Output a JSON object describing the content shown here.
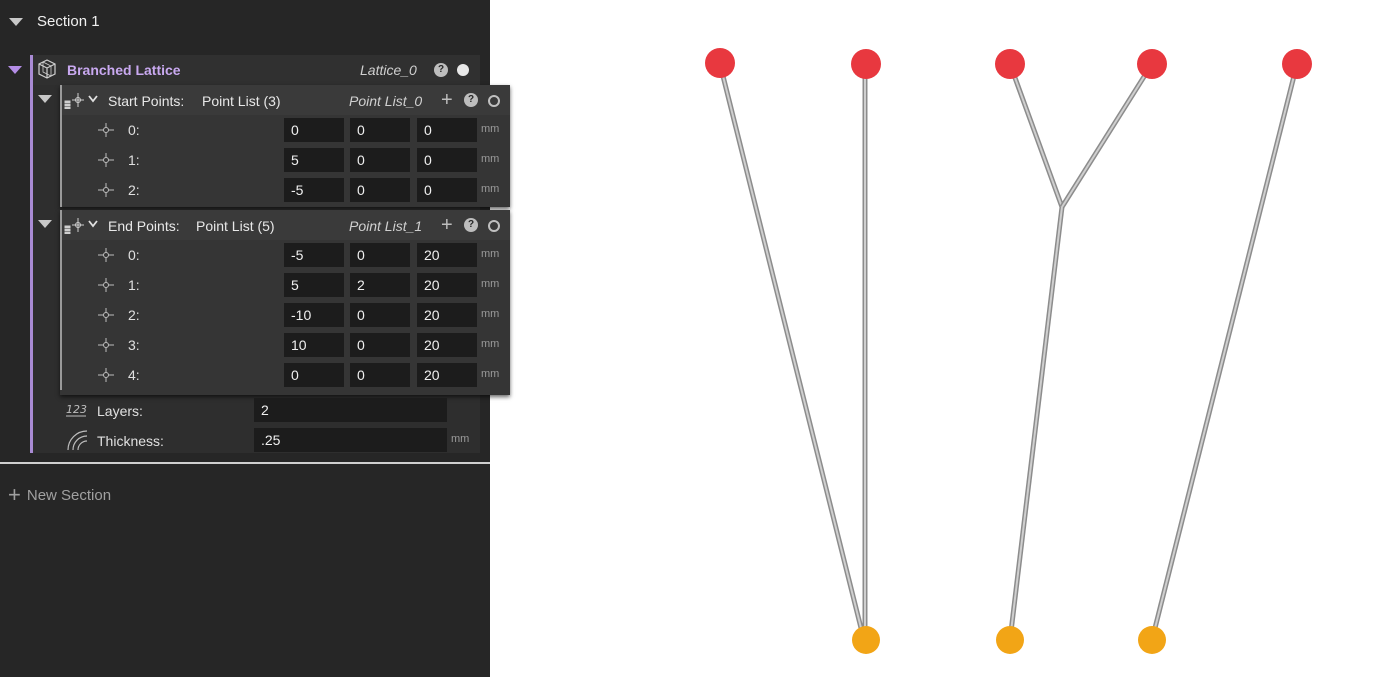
{
  "section": {
    "title": "Section 1"
  },
  "lattice": {
    "name": "Branched Lattice",
    "id": "Lattice_0",
    "help": "?",
    "accent_color": "#a98bd4",
    "icon": "cube-icon"
  },
  "start_points": {
    "label": "Start Points:",
    "type": "Point List (3)",
    "id": "Point List_0",
    "rows": [
      {
        "label": "0:",
        "x": "0",
        "y": "0",
        "z": "0",
        "unit": "mm"
      },
      {
        "label": "1:",
        "x": "5",
        "y": "0",
        "z": "0",
        "unit": "mm"
      },
      {
        "label": "2:",
        "x": "-5",
        "y": "0",
        "z": "0",
        "unit": "mm"
      }
    ]
  },
  "end_points": {
    "label": "End Points:",
    "type": "Point List (5)",
    "id": "Point List_1",
    "rows": [
      {
        "label": "0:",
        "x": "-5",
        "y": "0",
        "z": "20",
        "unit": "mm"
      },
      {
        "label": "1:",
        "x": "5",
        "y": "2",
        "z": "20",
        "unit": "mm"
      },
      {
        "label": "2:",
        "x": "-10",
        "y": "0",
        "z": "20",
        "unit": "mm"
      },
      {
        "label": "3:",
        "x": "10",
        "y": "0",
        "z": "20",
        "unit": "mm"
      },
      {
        "label": "4:",
        "x": "0",
        "y": "0",
        "z": "20",
        "unit": "mm"
      }
    ]
  },
  "layers": {
    "label": "Layers:",
    "value": "2",
    "icon": "123-icon"
  },
  "thickness": {
    "label": "Thickness:",
    "value": ".25",
    "unit": "mm",
    "icon": "thickness-icon"
  },
  "new_section": {
    "label": "New Section"
  },
  "viewport": {
    "strut_color": "#a8a8a8",
    "end_node_color": "#e8383f",
    "start_node_color": "#f2a516"
  }
}
